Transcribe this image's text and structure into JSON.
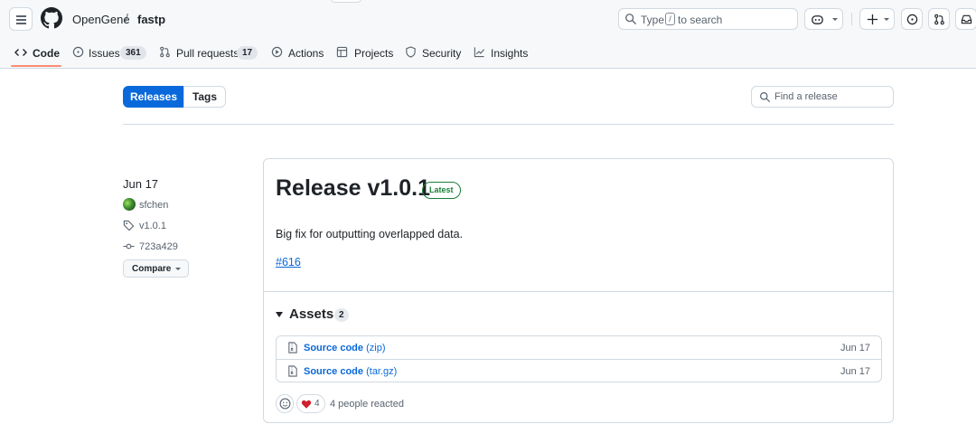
{
  "header": {
    "owner": "OpenGene",
    "separator": "/",
    "repo": "fastp",
    "search_text_before": "Type",
    "search_key": "/",
    "search_text_after": "to search"
  },
  "nav": {
    "tabs": [
      {
        "label": "Code"
      },
      {
        "label": "Issues",
        "count": "361"
      },
      {
        "label": "Pull requests",
        "count": "17"
      },
      {
        "label": "Actions"
      },
      {
        "label": "Projects"
      },
      {
        "label": "Security"
      },
      {
        "label": "Insights"
      }
    ]
  },
  "subnav": {
    "releases_label": "Releases",
    "tags_label": "Tags",
    "find_placeholder": "Find a release"
  },
  "release": {
    "date": "Jun 17",
    "author": "sfchen",
    "tag": "v1.0.1",
    "commit": "723a429",
    "compare_label": "Compare",
    "title": "Release v1.0.1",
    "badge": "Latest",
    "body": "Big fix for outputting overlapped data.",
    "link": "#616",
    "assets_title": "Assets",
    "assets_count": "2",
    "assets": [
      {
        "name": "Source code",
        "type": "(zip)",
        "date": "Jun 17"
      },
      {
        "name": "Source code",
        "type": "(tar.gz)",
        "date": "Jun 17"
      }
    ],
    "heart_count": "4",
    "reactions_text": "4 people reacted"
  },
  "colors": {
    "accent": "#0969da",
    "latest": "#1a7f37",
    "tab_underline": "#fd8c73",
    "heart": "#cf222e"
  }
}
